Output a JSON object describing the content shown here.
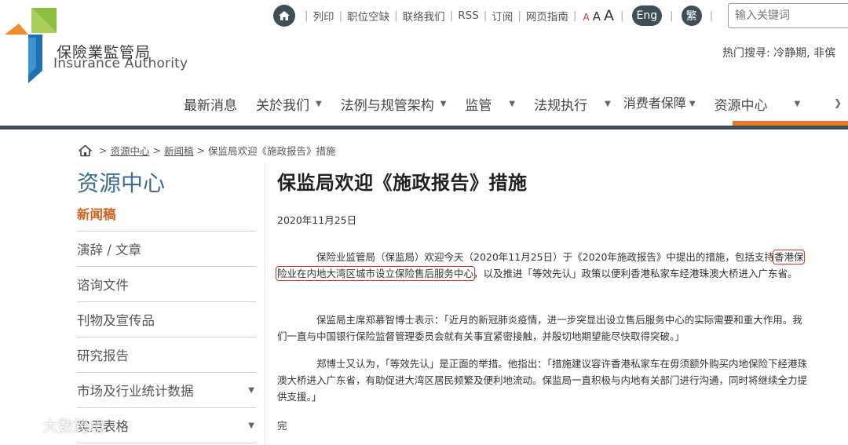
{
  "header": {
    "logo_cn": "保險業監管局",
    "logo_en": "Insurance Authority",
    "utility_links": [
      "列印",
      "职位空缺",
      "联络我们",
      "RSS",
      "订阅",
      "网页指南"
    ],
    "font_sizes": [
      "A",
      "A",
      "A"
    ],
    "lang_eng": "Eng",
    "lang_trad": "繁",
    "search_placeholder": "输入关键词",
    "hot_search": "热门搜寻: 冷静期, 非傧"
  },
  "nav": {
    "items": [
      "最新消息",
      "关於我们",
      "法例与规管架构",
      "监管",
      "法规执行",
      "消费者保障",
      "资源中心"
    ],
    "active": "资源中心"
  },
  "breadcrumb": {
    "items": [
      "资源中心",
      "新闻稿",
      "保监局欢迎《施政报告》措施"
    ]
  },
  "sidebar": {
    "title": "资源中心",
    "items": [
      "新闻稿",
      "演辞 / 文章",
      "谘询文件",
      "刊物及宣传品",
      "研究报告",
      "市场及行业统计数据",
      "实用表格"
    ]
  },
  "article": {
    "title": "保监局欢迎《施政报告》措施",
    "date": "2020年11月25日",
    "p1_before": "保险业监管局（保监局）欢迎今天（2020年11月25日）于《2020年施政报告》中提出的措施，包括支持",
    "p1_highlight": "香港保险业在内地大湾区城市设立保险售后服务中心",
    "p1_after": "，以及推进「等效先认」政策以便利香港私家车经港珠澳大桥进入广东省。",
    "p2": "保监局主席郑慕智博士表示：「近月的新冠肺炎疫情，进一步突显出设立售后服务中心的实际需要和重大作用。我们一直与中国银行保险监督管理委员会就有关事宜紧密接触，并殷切地期望能尽快取得突破。」",
    "p3": "郑博士又认为，「等效先认」是正面的举措。他指出：「措施建议容许香港私家车在毋须额外购买内地保险下经港珠澳大桥进入广东省，有助促进大湾区居民频繁及便利地流动。保监局一直积极与内地有关部门进行沟通，同时将继续全力提供支援。」",
    "end": "完"
  },
  "watermark": {
    "text": "大数跨境"
  },
  "colors": {
    "brand_dark": "#3f4f57",
    "accent_orange": "#e8782a",
    "logo_green": "#8cbf3f",
    "logo_blue": "#1f6fb2",
    "sidebar_title": "#3a6e8f",
    "highlight_red": "#d9342b"
  }
}
